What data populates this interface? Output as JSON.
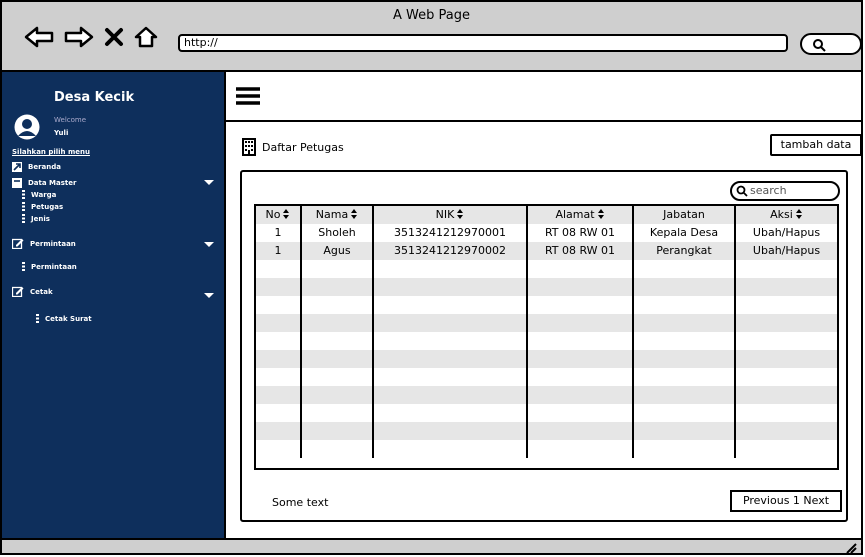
{
  "window": {
    "title": "A Web Page",
    "url": "http://"
  },
  "sidebar": {
    "brand": "Desa Kecik",
    "welcome": "Welcome",
    "user": "Yuli",
    "menu_hint": "Silahkan pilih menu",
    "items": [
      {
        "label": "Beranda"
      },
      {
        "label": "Data Master"
      },
      {
        "label": "Warga"
      },
      {
        "label": "Petugas"
      },
      {
        "label": "Jenis"
      },
      {
        "label": "Permintaan"
      },
      {
        "label": "Permintaan"
      },
      {
        "label": "Cetak"
      },
      {
        "label": "Cetak Surat"
      }
    ]
  },
  "main": {
    "page_title": "Daftar Petugas",
    "add_button": "tambah data",
    "search_placeholder": "search",
    "table": {
      "headers": [
        "No",
        "Nama",
        "NIK",
        "Alamat",
        "Jabatan",
        "Aksi"
      ],
      "rows": [
        [
          "1",
          "Sholeh",
          "3513241212970001",
          "RT 08 RW 01",
          "Kepala Desa",
          "Ubah/Hapus"
        ],
        [
          "1",
          "Agus",
          "3513241212970002",
          "RT 08 RW 01",
          "Perangkat",
          "Ubah/Hapus"
        ]
      ]
    },
    "footer_text": "Some text",
    "pager": "Previous 1 Next"
  }
}
